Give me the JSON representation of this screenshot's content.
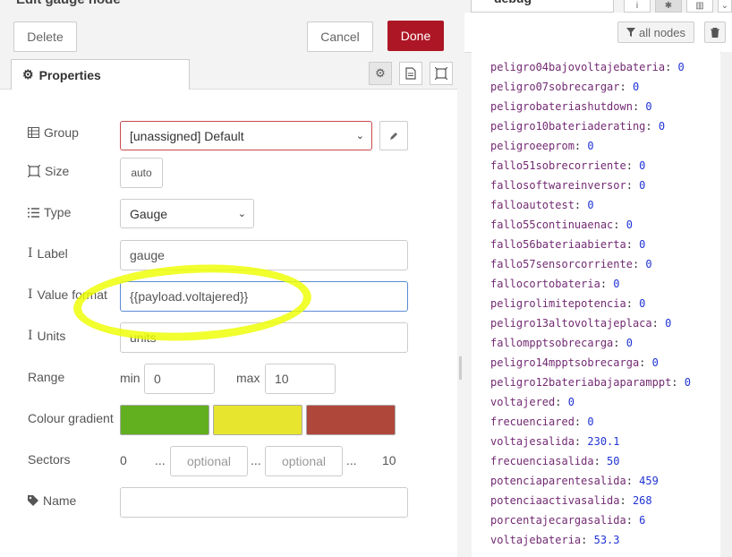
{
  "tray": {
    "title": "Edit gauge node",
    "delete_label": "Delete",
    "cancel_label": "Cancel",
    "done_label": "Done"
  },
  "tabs": {
    "properties_label": "Properties"
  },
  "form": {
    "group_label": "Group",
    "group_value": "[unassigned] Default",
    "size_label": "Size",
    "size_value": "auto",
    "type_label": "Type",
    "type_value": "Gauge",
    "label_label": "Label",
    "label_value": "gauge",
    "value_format_label": "Value format",
    "value_format_value": "{{payload.voltajered}}",
    "units_label": "Units",
    "units_value": "units",
    "range_label": "Range",
    "min_label": "min",
    "min_value": "0",
    "max_label": "max",
    "max_value": "10",
    "colour_gradient_label": "Colour gradient",
    "colours": [
      "#62b01f",
      "#e7e52d",
      "#b0473b"
    ],
    "sectors_label": "Sectors",
    "sector_start": "0",
    "sector_dots": "...",
    "sector_placeholder": "optional",
    "sector_end": "10",
    "name_label": "Name",
    "name_value": ""
  },
  "sidebar": {
    "tab_label": "debug",
    "filter_label": "all nodes"
  },
  "debug_messages": [
    {
      "key": "peligro04bajovoltajebateria",
      "value": "0"
    },
    {
      "key": "peligro07sobrecargar",
      "value": "0"
    },
    {
      "key": "peligrobateriashutdown",
      "value": "0"
    },
    {
      "key": "peligro10bateriaderating",
      "value": "0"
    },
    {
      "key": "peligroeeprom",
      "value": "0"
    },
    {
      "key": "fallo51sobrecorriente",
      "value": "0"
    },
    {
      "key": "fallosoftwareinversor",
      "value": "0"
    },
    {
      "key": "falloautotest",
      "value": "0"
    },
    {
      "key": "fallo55continuaenac",
      "value": "0"
    },
    {
      "key": "fallo56bateriaabierta",
      "value": "0"
    },
    {
      "key": "fallo57sensorcorriente",
      "value": "0"
    },
    {
      "key": "fallocortobateria",
      "value": "0"
    },
    {
      "key": "peligrolimitepotencia",
      "value": "0"
    },
    {
      "key": "peligro13altovoltajeplaca",
      "value": "0"
    },
    {
      "key": "fallompptsobrecarga",
      "value": "0"
    },
    {
      "key": "peligro14mpptsobrecarga",
      "value": "0"
    },
    {
      "key": "peligro12bateriabajaparamppt",
      "value": "0"
    },
    {
      "key": "voltajered",
      "value": "0"
    },
    {
      "key": "frecuenciared",
      "value": "0"
    },
    {
      "key": "voltajesalida",
      "value": "230.1"
    },
    {
      "key": "frecuenciasalida",
      "value": "50"
    },
    {
      "key": "potenciaparentesalida",
      "value": "459"
    },
    {
      "key": "potenciaactivasalida",
      "value": "268"
    },
    {
      "key": "porcentajecargasalida",
      "value": "6"
    },
    {
      "key": "voltajebateria",
      "value": "53.3"
    }
  ]
}
